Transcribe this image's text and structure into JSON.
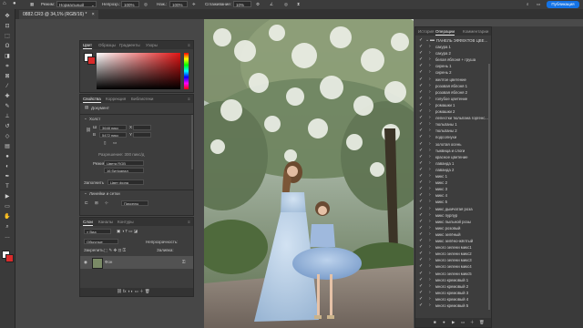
{
  "options_bar": {
    "mode_label": "Режим:",
    "mode_value": "Нормальный",
    "opacity_label": "Непрозр.:",
    "opacity_value": "100%",
    "flow_label": "Наж.:",
    "flow_value": "100%",
    "smoothing_label": "Сглаживание:",
    "smoothing_value": "10%",
    "publish_label": "Публикация"
  },
  "document_tab": {
    "title": "0882.CR3 @ 34,1% (RGB/16) *",
    "close": "×"
  },
  "tools": [
    {
      "icon": "move-tool-icon",
      "glyph": "✥"
    },
    {
      "icon": "artboard-icon",
      "glyph": "⊡"
    },
    {
      "icon": "marquee-icon",
      "glyph": "⬚"
    },
    {
      "icon": "lasso-icon",
      "glyph": "ʘ"
    },
    {
      "icon": "object-select-icon",
      "glyph": "◨"
    },
    {
      "icon": "crop-icon",
      "glyph": "⌗"
    },
    {
      "icon": "frame-icon",
      "glyph": "⊠"
    },
    {
      "icon": "eyedropper-icon",
      "glyph": "⁄"
    },
    {
      "icon": "healing-icon",
      "glyph": "✚"
    },
    {
      "icon": "brush-icon",
      "glyph": "✎"
    },
    {
      "icon": "clone-stamp-icon",
      "glyph": "⊥"
    },
    {
      "icon": "history-brush-icon",
      "glyph": "↺"
    },
    {
      "icon": "eraser-icon",
      "glyph": "◇"
    },
    {
      "icon": "gradient-icon",
      "glyph": "▤"
    },
    {
      "icon": "blur-icon",
      "glyph": "●"
    },
    {
      "icon": "dodge-icon",
      "glyph": "◐"
    },
    {
      "icon": "pen-icon",
      "glyph": "✒"
    },
    {
      "icon": "type-icon",
      "glyph": "T"
    },
    {
      "icon": "path-select-icon",
      "glyph": "▶"
    },
    {
      "icon": "shape-icon",
      "glyph": "▭"
    },
    {
      "icon": "hand-icon",
      "glyph": "✋"
    },
    {
      "icon": "zoom-icon",
      "glyph": "⌕"
    },
    {
      "icon": "more-tools-icon",
      "glyph": "…"
    }
  ],
  "color_panel": {
    "tabs": [
      "Цвет",
      "Образцы",
      "Градиенты",
      "Узоры"
    ],
    "foreground": "#ffffff",
    "background": "#d92b2b"
  },
  "properties_panel": {
    "tabs": [
      "Свойства",
      "Коррекция",
      "Библиотеки"
    ],
    "doc_label": "Документ",
    "canvas_section": "Холст",
    "w_label": "Ш",
    "w_value": "3648 пикс",
    "x_label": "X",
    "h_label": "В",
    "h_value": "5472 пикс",
    "y_label": "Y",
    "resolution": "Разрешение: 300 пикс/д",
    "mode_label": "Режим",
    "mode_value": "Цвета RGB",
    "depth_value": "16 бит/канал",
    "fill_label": "Заполнить",
    "fill_value": "Цвет фона",
    "rulers_section": "Линейки и сетки",
    "units_value": "Пикселы"
  },
  "layers_panel": {
    "tabs": [
      "Слои",
      "Каналы",
      "Контуры"
    ],
    "filter_placeholder": "Вид",
    "blend_mode": "Обычные",
    "opacity_label": "Непрозрачность:",
    "lock_label": "Закрепить:",
    "fill_label": "Заливка:",
    "layer_name": "Фон"
  },
  "actions_panel": {
    "tabs": [
      "История",
      "Операции",
      "Комментарии"
    ],
    "folder": "ПАНЕЛЬ ЭФФЕКТОВ ЦВЕ...",
    "items": [
      "сакура 1",
      "сакура 2",
      "белая яблоня + груша",
      "сирень 1",
      "сирень 2",
      "желтое цветение",
      "розовая яблоня 1",
      "розовая яблоня 2",
      "голубое цветение",
      "ромашки 1",
      "ромашки 2",
      "лепестки тюльпана горгенс...",
      "тюльпаны 1",
      "тюльпаны 2",
      "подсолнухи",
      "золотая осень",
      "тыквица и слоги",
      "красное цветение",
      "лаванда 1",
      "лаванда 2",
      "микс 1",
      "микс 2",
      "микс 3",
      "микс 4",
      "микс 5",
      "микс дымчатая роза",
      "микс пурпур",
      "микс пыльной розы",
      "микс розовый",
      "микс зелёный",
      "микс зелёно-жёлтый",
      "много зелени микс1",
      "много зелени микс2",
      "много зелени микс3",
      "много зелени микс4",
      "много зелени микс5",
      "много кремовый 1",
      "много кремовый 2",
      "много кремовый 3",
      "много кремовый 4",
      "много кремовый 5"
    ]
  },
  "colors": {
    "accent": "#1473e6",
    "panel": "#3d3d3d",
    "panel_header": "#333333"
  }
}
